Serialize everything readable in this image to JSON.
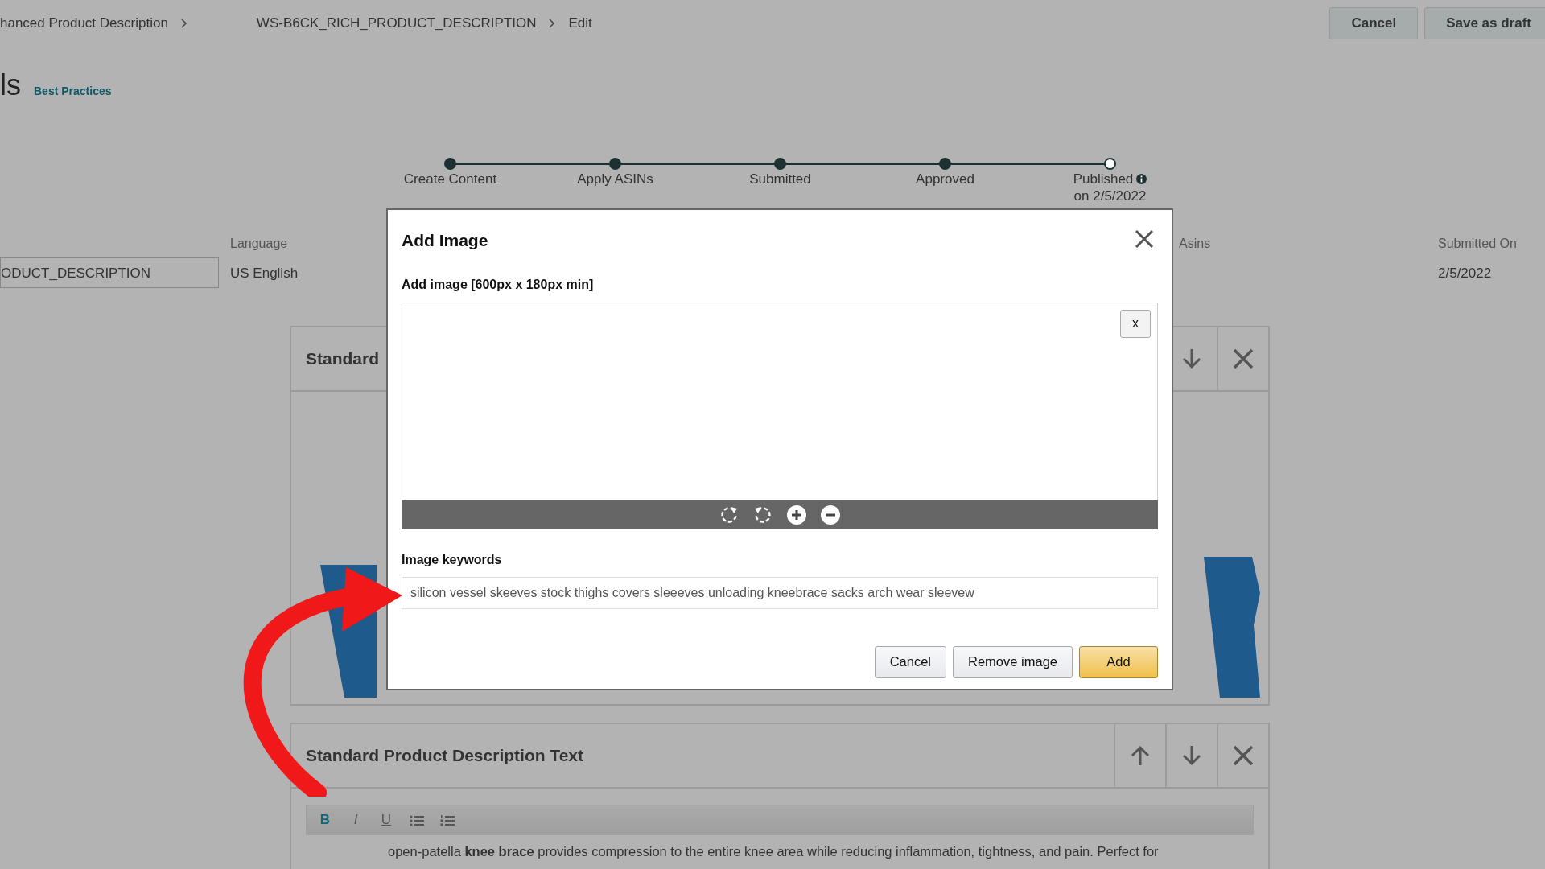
{
  "breadcrumb": [
    {
      "text": "hanced Product Description"
    },
    {
      "text": "WS-B6CK_RICH_PRODUCT_DESCRIPTION"
    },
    {
      "text": "Edit"
    }
  ],
  "header_buttons": [
    {
      "label": "Cancel"
    },
    {
      "label": "Save as draft"
    }
  ],
  "title": "ls",
  "best_practices": "Best Practices",
  "steps": [
    {
      "label": "Create Content",
      "done": true
    },
    {
      "label": "Apply ASINs",
      "done": true
    },
    {
      "label": "Submitted",
      "done": true
    },
    {
      "label": "Approved",
      "done": true
    },
    {
      "label": "Published",
      "done": false,
      "info": true,
      "date": "on 2/5/2022"
    }
  ],
  "details": {
    "name_value": "ODUCT_DESCRIPTION",
    "language_label": "Language",
    "language_value": "US English",
    "asins_label": "Asins",
    "submitted_label": "Submitted On",
    "submitted_value": "2/5/2022"
  },
  "modules": [
    {
      "title": "Standard"
    },
    {
      "title": "Standard Product Description Text",
      "toolbar": [
        {
          "kind": "bold",
          "label": "B"
        },
        {
          "kind": "italic",
          "label": "I"
        },
        {
          "kind": "underline",
          "label": "U"
        },
        {
          "kind": "bullets"
        },
        {
          "kind": "numbers"
        }
      ],
      "text": "open-patella **knee brace** provides compression to the entire knee area while reducing inflammation, tightness, and pain. Perfect for"
    }
  ],
  "modal": {
    "title": "Add Image",
    "image_label": "Add image [600px x 180px min]",
    "remove_x": "x",
    "keywords_label": "Image keywords",
    "keywords_value": "silicon vessel skeeves stock thighs covers sleeeves unloading kneebrace sacks arch wear sleevew",
    "buttons": [
      {
        "label": "Cancel",
        "kind": "plain"
      },
      {
        "label": "Remove image",
        "kind": "plain"
      },
      {
        "label": "Add",
        "kind": "primary"
      }
    ]
  }
}
